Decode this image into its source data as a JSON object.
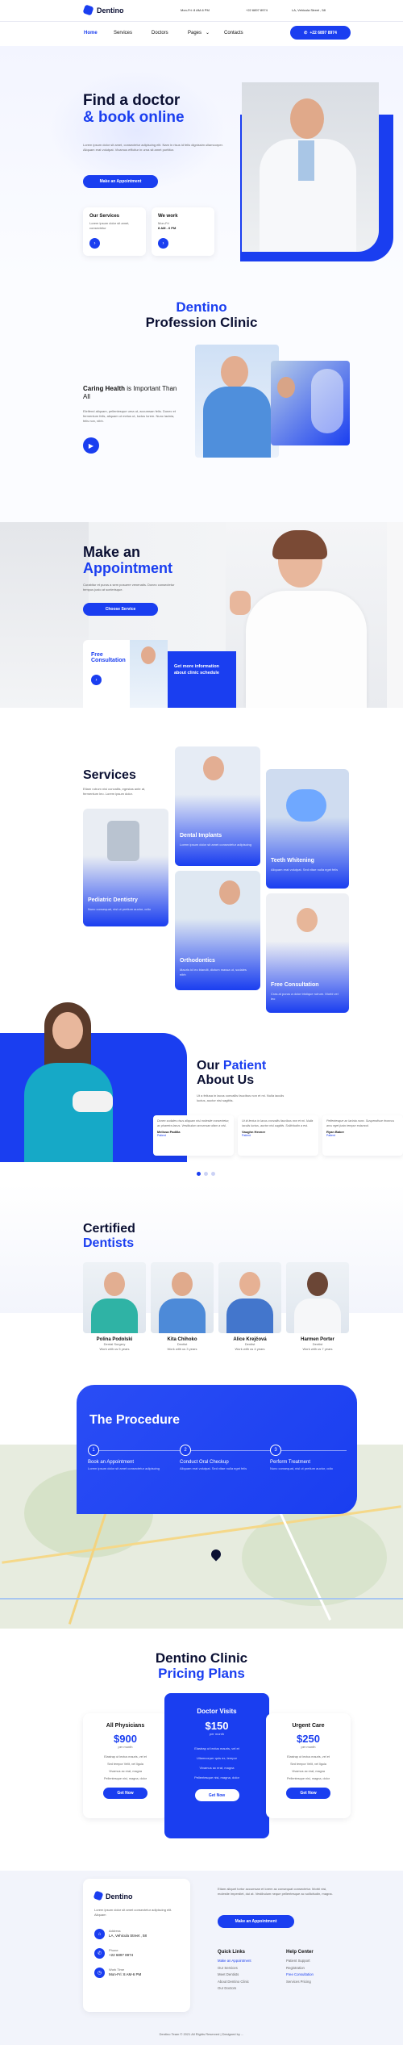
{
  "header": {
    "logo": "Dentino",
    "hours": "Mon-Fri: 8 AM-6 PM",
    "phone": "+22 6897 8974",
    "address": "LA, Vehicula Street , 58"
  },
  "nav": {
    "items": [
      "Home",
      "Services",
      "Doctors",
      "Pages",
      "Contacts"
    ],
    "phone_button": "+22 6897 8974"
  },
  "hero": {
    "title_line1": "Find a doctor",
    "title_line2": "& book online",
    "text": "Lorem ipsum dolor sit amet, consectetur adipiscing elit. Nam in risus id felis dignissim ullamcorper. Aliquam erat volutpat. Vivamus efficitur in urna sit amet porttitor.",
    "button": "Make an Appointment",
    "card1_title": "Our Services",
    "card1_text": "Lorem ipsum dolor sit amet, consectetur",
    "card2_title": "We work",
    "card2_text": "Mon-Fri",
    "card2_hours": "8 AM - 6 PM"
  },
  "clinic": {
    "title1": "Dentino",
    "title2": "Profession Clinic",
    "subtitle_a": "Caring Health",
    "subtitle_b": " is Important Than All",
    "text": "Eleifend aliquam, pellentesque urna ut, accumsan felis. Donec et fermentum felis, aliquam ut metus ut, luctus lorem. Nunc lacinia, felis non, nibh."
  },
  "appointment": {
    "title1": "Make an",
    "title2": "Appointment",
    "text": "Curabitur et purus a sem posuere venenatis. Donec consectetur tempus justo at scelerisque.",
    "button": "Choose Service",
    "card1": "Free Consultation",
    "card2": "Get more information about clinic schedule"
  },
  "services": {
    "title": "Services",
    "text": "Etiam rutrum nisi convallis, egestas ante at, fermentum leo. Lorem ipsum dolor.",
    "items": [
      {
        "name": "Dental Implants",
        "text": "Lorem ipsum dolor sit amet consectetur adipiscing"
      },
      {
        "name": "Teeth Whitening",
        "text": "Aliquam erat volutpat. Sed vitae nulla eget felis"
      },
      {
        "name": "Pediatric Dentistry",
        "text": "Nunc consequat, nisl ut pretium auctor, odio"
      },
      {
        "name": "Orthodontics",
        "text": "Mauris id leo blandit, dictum massa ut, sodales nibh"
      },
      {
        "name": "Free Consultation",
        "text": "Cras at purus a dolor tristique rutrum. Morbi vel leo"
      }
    ]
  },
  "patients": {
    "title1": "Our ",
    "title2": "Patient",
    "title3": "About Us",
    "text": "Ut a feliusa in lacus convallis faucibus non et mi. Nulla iaculis luctus, auctor nisi sagittis.",
    "reviews": [
      {
        "text": "Donec sodales risus aliquam nisl molestie consectetur, ac pharetra lacus. Vestibulum accumsan diam a nisl.",
        "name": "Melissa Padilla",
        "role": "Patient"
      },
      {
        "text": "Ut id lectus in lacus convallis faucibus non et mi. Nulla iaculis luctus, auctor nisl sagittis. Sollicitudin a est.",
        "name": "Vaughn Hevner",
        "role": "Patient"
      },
      {
        "text": "Pellentesque ac lacinia nunc. Suspendisse rhoncus arcu eget justo tempor euismod.",
        "name": "Ryan Baker",
        "role": "Patient"
      }
    ]
  },
  "dentists": {
    "title1": "Certified",
    "title2": "Dentists",
    "people": [
      {
        "name": "Polina Podolski",
        "role": "Dental Surgery",
        "exp": "Work with us 5 years"
      },
      {
        "name": "Kita Chihoko",
        "role": "Dentist",
        "exp": "Work with us 3 years"
      },
      {
        "name": "Alice Krejčová",
        "role": "Dentist",
        "exp": "Work with us 4 years"
      },
      {
        "name": "Harmen Porter",
        "role": "Dentist",
        "exp": "Work with us 7 years"
      }
    ]
  },
  "procedure": {
    "title": "The Procedure",
    "steps": [
      {
        "num": "1",
        "name": "Book an Appointment",
        "text": "Lorem ipsum dolor sit amet consectetur adipiscing"
      },
      {
        "num": "2",
        "name": "Conduct Oral Checkup",
        "text": "Aliquam erat volutpat. Sed vitae nulla eget felis"
      },
      {
        "num": "3",
        "name": "Perform Treatment",
        "text": "Nunc consequat, nisl ut pretium auctor, odio"
      }
    ]
  },
  "pricing": {
    "title1": "Dentino Clinic",
    "title2": "Pricing Plans",
    "plans": [
      {
        "name": "All Physicians",
        "price": "$900",
        "period": "per month",
        "features": [
          "Elastrap ut lectus mauris, vel et",
          "Sed tempor Velit, vel ligula",
          "Vivamus ac erat, magna",
          "Pellentesque nisi, magna, dolor"
        ],
        "button": "Get Now"
      },
      {
        "name": "Doctor Visits",
        "price": "$150",
        "period": "per month",
        "features": [
          "Elastrap ut lectus mauris, vel et",
          "Ullamcorper quis ex, tempor",
          "Vivamus ac erat, magna",
          "Pellentesque nisi, magna, dolor"
        ],
        "button": "Get Now"
      },
      {
        "name": "Urgent Care",
        "price": "$250",
        "period": "per month",
        "features": [
          "Elastrap ut lectus mauris, vel et",
          "Sed tempor Velit, vel ligula",
          "Vivamus ac erat, magna",
          "Pellentesque nisi, magna, dolor"
        ],
        "button": "Get Now"
      }
    ]
  },
  "footer": {
    "logo": "Dentino",
    "text": "Lorem ipsum dolor sit amet consectetur adipiscing elit. Aliquam",
    "address_label": "Address",
    "address": "LA, Vehicula Street , 58",
    "phone_label": "Phone",
    "phone": "+22 6897 8974",
    "hours_label": "Work Time",
    "hours": "Mon-Fri: 8 AM-6 PM",
    "right_text": "Etiam aliquet tortor accumsan et lorem ac consequat consectetur. Morbi nisi, molestie imperdiet, dui at. Vestibulum neque pellentesque ac sollicitudin, magna.",
    "button": "Make an Appointment",
    "col1_title": "Quick Links",
    "col1": [
      "Make an Appointment",
      "Our Services",
      "Meet Dentists",
      "About Dentino Clinic",
      "Our Doctors"
    ],
    "col2_title": "Help Center",
    "col2": [
      "Patient Support",
      "Registration",
      "Free Consultation",
      "Services Pricing"
    ],
    "copyright": "Dentino Team © 2021 All Rights Reserved | Designed by ..."
  }
}
